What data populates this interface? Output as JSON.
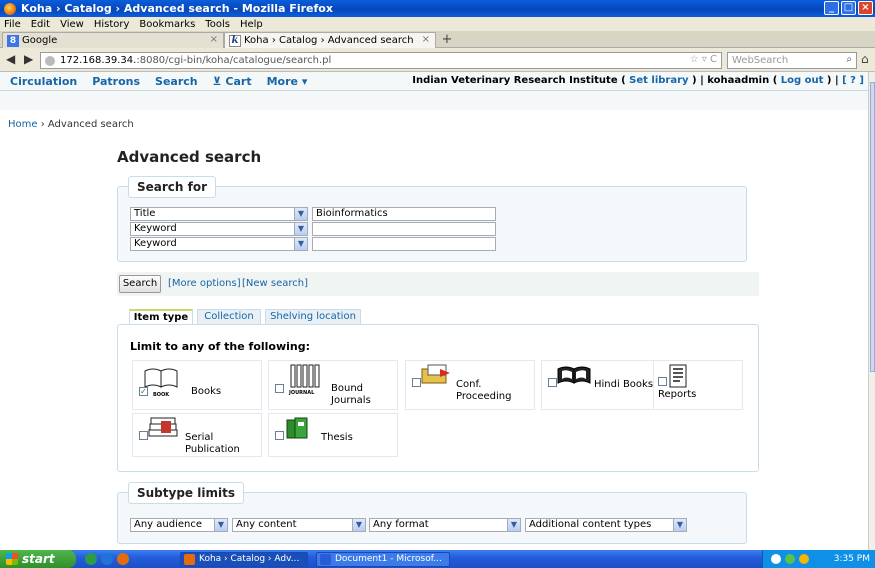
{
  "window": {
    "title": "Koha › Catalog › Advanced search - Mozilla Firefox"
  },
  "menubar": [
    "File",
    "Edit",
    "View",
    "History",
    "Bookmarks",
    "Tools",
    "Help"
  ],
  "browser_tabs": [
    {
      "label": "Google",
      "icon": "google-icon"
    },
    {
      "label": "Koha › Catalog › Advanced search",
      "icon": "koha-icon"
    }
  ],
  "new_tab": "+",
  "url": {
    "host": "172.168.39.34.",
    "rest": ":8080/cgi-bin/koha/catalogue/search.pl"
  },
  "websearch_placeholder": "WebSearch",
  "koha_nav": [
    "Circulation",
    "Patrons",
    "Search",
    "Cart",
    "More"
  ],
  "library": {
    "name": "Indian Veterinary Research Institute",
    "set_library": "Set library",
    "user": "kohaadmin",
    "logout": "Log out",
    "help": "[ ? ]"
  },
  "breadcrumb": {
    "home": "Home",
    "sep": " › ",
    "current": "Advanced search"
  },
  "page_title": "Advanced search",
  "search_for": {
    "legend": "Search for",
    "rows": [
      {
        "index": "Title",
        "value": "Bioinformatics"
      },
      {
        "index": "Keyword",
        "value": ""
      },
      {
        "index": "Keyword",
        "value": ""
      }
    ]
  },
  "actions": {
    "search": "Search",
    "more": "[More options]",
    "new": "[New search]"
  },
  "item_tabs": [
    "Item type",
    "Collection",
    "Shelving location"
  ],
  "limit_title": "Limit to any of the following:",
  "item_types": [
    {
      "label": "Books",
      "checked": true,
      "icon": "book-icon",
      "badge": "BOOK"
    },
    {
      "label": "Bound Journals",
      "checked": false,
      "icon": "journal-icon",
      "badge": "JOURNAL"
    },
    {
      "label": "Conf. Proceeding",
      "checked": false,
      "icon": "folder-icon"
    },
    {
      "label": "Hindi Books",
      "checked": false,
      "icon": "open-book-icon"
    },
    {
      "label": "Reports",
      "checked": false,
      "icon": "report-icon"
    },
    {
      "label": "Serial Publication",
      "checked": false,
      "icon": "serial-icon"
    },
    {
      "label": "Thesis",
      "checked": false,
      "icon": "thesis-icon"
    }
  ],
  "subtype": {
    "legend": "Subtype limits",
    "selects": [
      "Any audience",
      "Any content",
      "Any format",
      "Additional content types"
    ]
  },
  "taskbar": {
    "start": "start",
    "tasks": [
      "Koha › Catalog › Adv...",
      "Document1 - Microsof..."
    ],
    "clock": "3:35 PM"
  },
  "colors": {
    "link": "#1565a8",
    "legend_border": "#c9dcea",
    "tab_accent": "#c8d86a"
  }
}
